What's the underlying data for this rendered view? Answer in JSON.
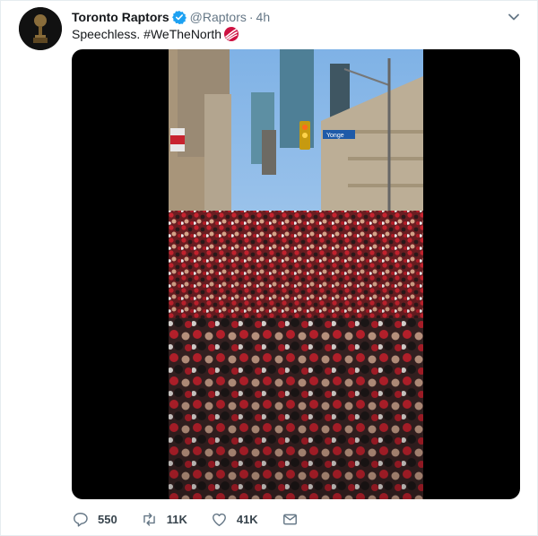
{
  "tweet": {
    "author_name": "Toronto Raptors",
    "handle": "@Raptors",
    "separator": "·",
    "time": "4h",
    "text": "Speechless. #WeTheNorth",
    "street_sign": "Yonge",
    "icons": {
      "avatar": "trophy-avatar",
      "verified": "verified-badge-icon",
      "caret": "chevron-down-icon",
      "hashtag": "raptors-claw-icon",
      "reply": "reply-icon",
      "retweet": "retweet-icon",
      "like": "heart-icon",
      "dm": "envelope-icon"
    },
    "actions": {
      "replies": "550",
      "retweets": "11K",
      "likes": "41K"
    },
    "colors": {
      "verified": "#1da1f2",
      "hashtag": "#ce1141",
      "muted": "#657786",
      "text": "#14171a"
    }
  }
}
